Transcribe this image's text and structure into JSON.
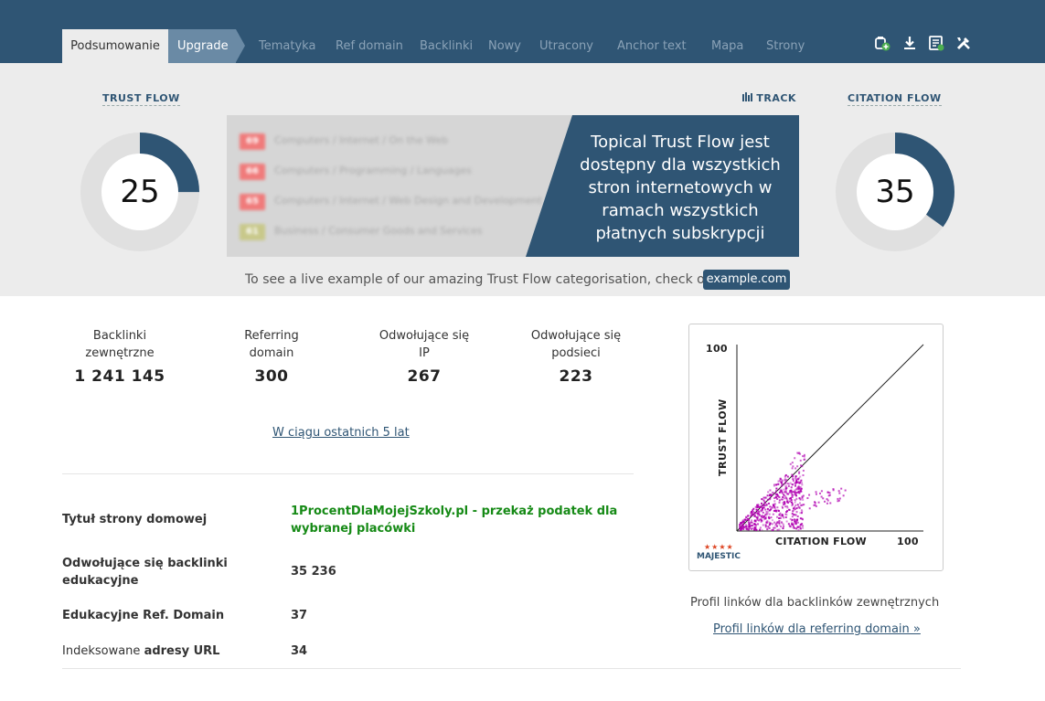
{
  "nav": {
    "active_tab": "Podsumowanie",
    "upgrade_tab": "Upgrade",
    "tabs": [
      "Tematyka",
      "Ref domain",
      "Backlinki",
      "Nowy",
      "Utracony",
      "Anchor text",
      "Mapa",
      "Strony"
    ]
  },
  "toolbar": {
    "icons": [
      "add-bucket-icon",
      "download-icon",
      "report-icon",
      "tools-icon"
    ]
  },
  "trust_flow": {
    "label": "TRUST FLOW",
    "value": "25",
    "fraction": 0.25
  },
  "citation_flow": {
    "label": "CITATION FLOW",
    "value": "35",
    "fraction": 0.35
  },
  "track": {
    "label": "TRACK"
  },
  "promo": {
    "text": "Topical Trust Flow jest dostępny dla wszystkich stron internetowych w ramach wszystkich płatnych subskrypcji",
    "rows": [
      {
        "score": "69",
        "color": "#f07a7a",
        "label": "Computers / Internet / On the Web"
      },
      {
        "score": "66",
        "color": "#f07a7a",
        "label": "Computers / Programming / Languages"
      },
      {
        "score": "65",
        "color": "#f07a7a",
        "label": "Computers / Internet / Web Design and Development"
      },
      {
        "score": "61",
        "color": "#c8c88a",
        "label": "Business / Consumer Goods and Services"
      }
    ]
  },
  "live_example": {
    "text": "To see a live example of our amazing Trust Flow categorisation, check out",
    "button": "example.com"
  },
  "stats": [
    {
      "label_line1": "Backlinki",
      "label_line2": "zewnętrzne",
      "value": "1 241 145"
    },
    {
      "label_line1": "Referring",
      "label_line2": "domain",
      "value": "300"
    },
    {
      "label_line1": "Odwołujące się",
      "label_line2": "IP",
      "value": "267"
    },
    {
      "label_line1": "Odwołujące się",
      "label_line2": "podsieci",
      "value": "223"
    }
  ],
  "period_link": "W ciągu ostatnich 5 lat",
  "info": {
    "homepage_title_label": "Tytuł strony domowej",
    "homepage_title_value": "1ProcentDlaMojejSzkoly.pl - przekaż podatek dla wybranej placówki",
    "edu_backlinks_label": "Odwołujące się backlinki edukacyjne",
    "edu_backlinks_value": "35 236",
    "edu_refdomain_label": "Edukacyjne Ref. Domain",
    "edu_refdomain_value": "37",
    "indexed_label_prefix": "Indeksowane",
    "indexed_label_bold": "adresy URL",
    "indexed_value": "34"
  },
  "flow_chart": {
    "y_axis_label": "TRUST FLOW",
    "x_axis_label": "CITATION FLOW",
    "y_max_label": "100",
    "x_max_label": "100",
    "logo": "MAJESTIC",
    "point_color": "#b000b0"
  },
  "profile": {
    "text": "Profil linków dla backlinków zewnętrznych",
    "link": "Profil linków dla referring domain »"
  }
}
